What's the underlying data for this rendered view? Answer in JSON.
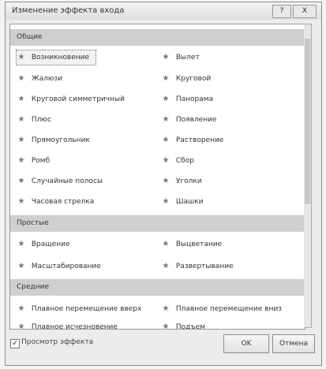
{
  "window": {
    "title": "Изменение эффекта входа",
    "help_label": "?",
    "close_label": "X"
  },
  "sections": [
    {
      "name": "Общие",
      "items": [
        "Возникновение",
        "Вылет",
        "Жалюзи",
        "Круговой",
        "Круговой симметричный",
        "Панорама",
        "Плюс",
        "Появление",
        "Прямоугольник",
        "Растворение",
        "Ромб",
        "Сбор",
        "Случайные полосы",
        "Уголки",
        "Часовая стрелка",
        "Шашки"
      ]
    },
    {
      "name": "Простые",
      "items": [
        "Вращение",
        "Выцветание",
        "Масштабирование",
        "Развертывание"
      ]
    },
    {
      "name": "Средние",
      "items": [
        "Плавное перемещение вверх",
        "Плавное перемещение вниз",
        "Плавное исчезновение",
        "Подъем"
      ]
    }
  ],
  "selected_item": "Возникновение",
  "footer": {
    "preview_label": "Просмотр эффекта",
    "preview_checked": true,
    "ok_label": "OK",
    "cancel_label": "Отмена"
  }
}
